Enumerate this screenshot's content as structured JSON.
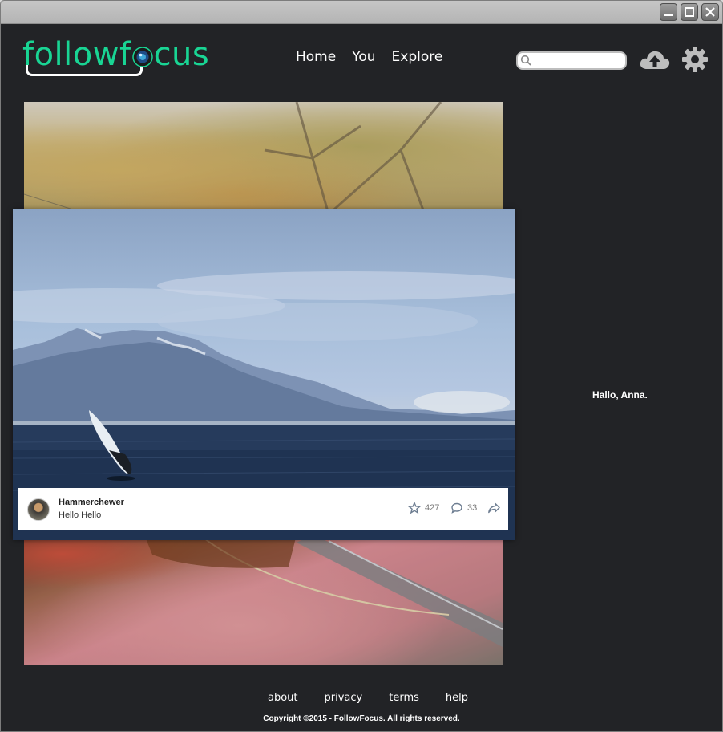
{
  "brand": {
    "name_pre": "followf",
    "name_post": "cus"
  },
  "nav": {
    "home": "Home",
    "you": "You",
    "explore": "Explore"
  },
  "search": {
    "placeholder": "",
    "value": ""
  },
  "post": {
    "username": "Hammerchewer",
    "title": "Hello Hello",
    "favorites": "427",
    "comments": "33"
  },
  "greeting": "Hallo, Anna.",
  "footer": {
    "about": "about",
    "privacy": "privacy",
    "terms": "terms",
    "help": "help",
    "copyright": "Copyright ©2015 - FollowFocus. All rights reserved."
  },
  "colors": {
    "brand": "#19d594",
    "background": "#222326",
    "titlebar": "#bdbdbd"
  },
  "icons": [
    "minimize-icon",
    "maximize-icon",
    "close-icon",
    "search-icon",
    "upload-cloud-icon",
    "gear-icon",
    "star-icon",
    "comment-icon",
    "share-icon"
  ]
}
